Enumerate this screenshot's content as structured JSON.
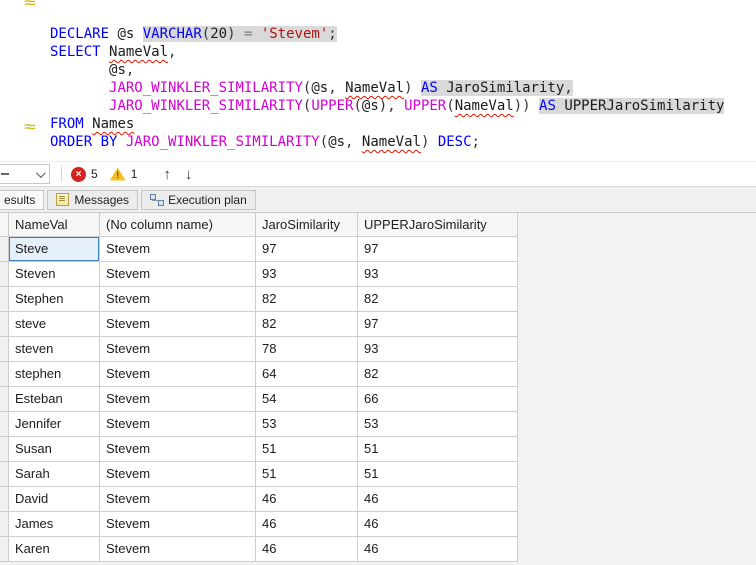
{
  "colors": {
    "keyword": "#0000ff",
    "function": "#d400d4",
    "string": "#b01414",
    "highlight_bg": "#d9d9d9",
    "squiggle_red": "#e51400",
    "change_marker_yellow": "#d8b511",
    "error_red": "#d0261f",
    "warning_yellow": "#f7bf27",
    "selection_border_blue": "#3f80c3"
  },
  "editor": {
    "change_marker_glyph": "≈",
    "lines": [
      {
        "tokens": [
          [
            "DECLARE",
            "kw"
          ],
          [
            " ",
            "sp"
          ],
          [
            "@s",
            "id"
          ],
          [
            " ",
            "sp"
          ],
          [
            "VARCHAR",
            "kw",
            "h"
          ],
          [
            "(",
            "pn",
            "h"
          ],
          [
            "20",
            "id",
            "h"
          ],
          [
            ")",
            "pn",
            "h"
          ],
          [
            " ",
            "sp",
            "h"
          ],
          [
            "=",
            "op",
            "h"
          ],
          [
            " ",
            "sp",
            "h"
          ],
          [
            "'Stevem'",
            "str",
            "h"
          ],
          [
            ";",
            "pn",
            "h"
          ]
        ]
      },
      {
        "tokens": [
          [
            "SELECT",
            "kw"
          ],
          [
            " ",
            "sp"
          ],
          [
            "NameVal",
            "id",
            "s"
          ],
          [
            ",",
            "pn"
          ]
        ]
      },
      {
        "tokens": [
          [
            "       ",
            "sp"
          ],
          [
            "@s",
            "id"
          ],
          [
            ",",
            "pn"
          ]
        ]
      },
      {
        "tokens": [
          [
            "       ",
            "sp"
          ],
          [
            "JARO_WINKLER_SIMILARITY",
            "fn"
          ],
          [
            "(",
            "pn"
          ],
          [
            "@s",
            "id"
          ],
          [
            ",",
            "pn"
          ],
          [
            " ",
            "sp"
          ],
          [
            "NameVal",
            "id",
            "s"
          ],
          [
            ")",
            "pn"
          ],
          [
            " ",
            "sp"
          ],
          [
            "AS",
            "kw",
            "h"
          ],
          [
            " ",
            "sp",
            "h"
          ],
          [
            "JaroSimilarity",
            "id",
            "h"
          ],
          [
            ",",
            "pn",
            "h"
          ]
        ]
      },
      {
        "tokens": [
          [
            "       ",
            "sp"
          ],
          [
            "JARO_WINKLER_SIMILARITY",
            "fn"
          ],
          [
            "(",
            "pn"
          ],
          [
            "UPPER",
            "fn"
          ],
          [
            "(",
            "pn"
          ],
          [
            "@s",
            "id"
          ],
          [
            ")",
            "pn"
          ],
          [
            ",",
            "pn"
          ],
          [
            " ",
            "sp"
          ],
          [
            "UPPER",
            "fn"
          ],
          [
            "(",
            "pn"
          ],
          [
            "NameVal",
            "id",
            "s"
          ],
          [
            ")",
            "pn"
          ],
          [
            ")",
            "pn"
          ],
          [
            " ",
            "sp"
          ],
          [
            "AS",
            "kw",
            "h"
          ],
          [
            " ",
            "sp",
            "h"
          ],
          [
            "UPPERJaroSimilarity",
            "id",
            "h"
          ]
        ]
      },
      {
        "tokens": [
          [
            "FROM",
            "kw"
          ],
          [
            " ",
            "sp"
          ],
          [
            "Names",
            "id",
            "s"
          ]
        ]
      },
      {
        "tokens": [
          [
            "ORDER BY",
            "kw"
          ],
          [
            " ",
            "sp"
          ],
          [
            "JARO_WINKLER_SIMILARITY",
            "fn"
          ],
          [
            "(",
            "pn"
          ],
          [
            "@s",
            "id"
          ],
          [
            ",",
            "pn"
          ],
          [
            " ",
            "sp"
          ],
          [
            "NameVal",
            "id",
            "s"
          ],
          [
            ")",
            "pn"
          ],
          [
            " ",
            "sp"
          ],
          [
            "DESC",
            "kw"
          ],
          [
            ";",
            "pn"
          ]
        ]
      }
    ]
  },
  "status_bar": {
    "error_icon": "×",
    "error_count": "5",
    "warning_icon": "!",
    "warning_count": "1",
    "up_arrow": "↑",
    "down_arrow": "↓"
  },
  "results_tabs": [
    {
      "label": "esults",
      "icon": "",
      "active": true
    },
    {
      "label": "Messages",
      "icon": "note",
      "active": false
    },
    {
      "label": "Execution plan",
      "icon": "plan",
      "active": false
    }
  ],
  "grid": {
    "columns": [
      "NameVal",
      "(No column name)",
      "JaroSimilarity",
      "UPPERJaroSimilarity"
    ],
    "rows": [
      [
        "Steve",
        "Stevem",
        "97",
        "97"
      ],
      [
        "Steven",
        "Stevem",
        "93",
        "93"
      ],
      [
        "Stephen",
        "Stevem",
        "82",
        "82"
      ],
      [
        "steve",
        "Stevem",
        "82",
        "97"
      ],
      [
        "steven",
        "Stevem",
        "78",
        "93"
      ],
      [
        "stephen",
        "Stevem",
        "64",
        "82"
      ],
      [
        "Esteban",
        "Stevem",
        "54",
        "66"
      ],
      [
        "Jennifer",
        "Stevem",
        "53",
        "53"
      ],
      [
        "Susan",
        "Stevem",
        "51",
        "51"
      ],
      [
        "Sarah",
        "Stevem",
        "51",
        "51"
      ],
      [
        "David",
        "Stevem",
        "46",
        "46"
      ],
      [
        "James",
        "Stevem",
        "46",
        "46"
      ],
      [
        "Karen",
        "Stevem",
        "46",
        "46"
      ]
    ],
    "selected_cell": {
      "row": 0,
      "col": 0
    }
  }
}
